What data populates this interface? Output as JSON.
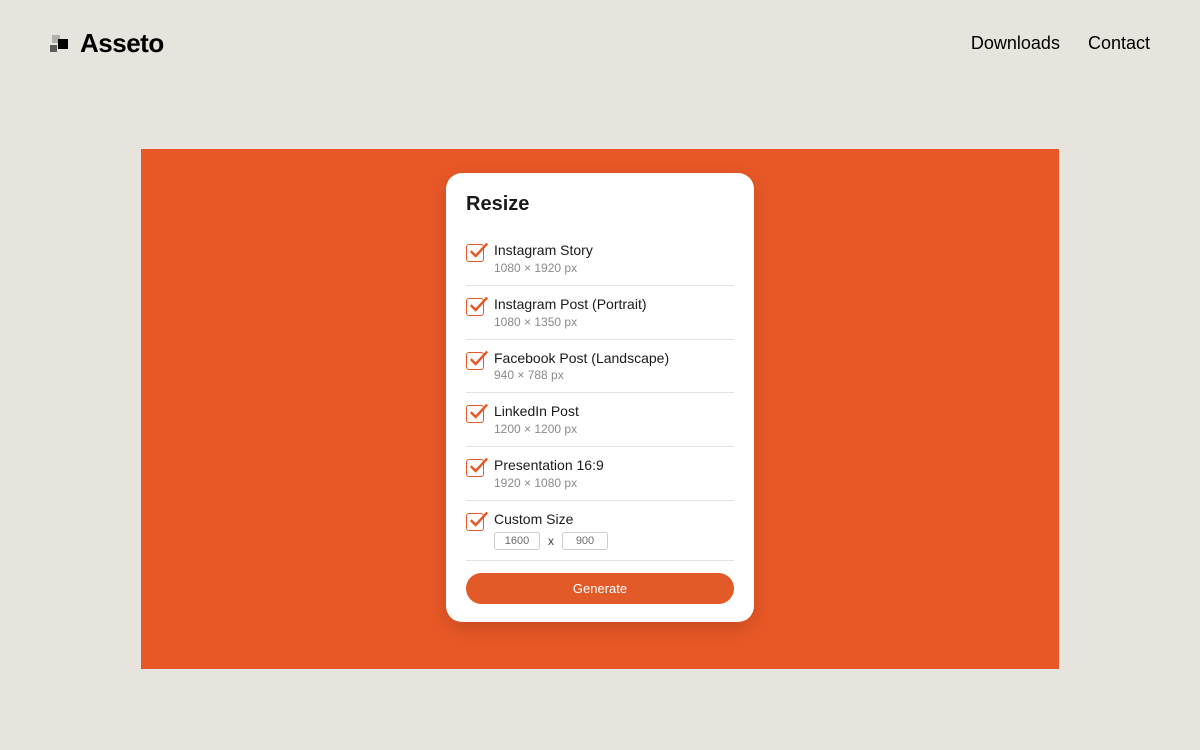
{
  "colors": {
    "accent": "#e85826",
    "page_bg": "#e6e4dd"
  },
  "header": {
    "brand_name": "Asseto",
    "nav": {
      "downloads": "Downloads",
      "contact": "Contact"
    }
  },
  "card": {
    "title": "Resize",
    "options": [
      {
        "label": "Instagram Story",
        "dimensions": "1080 × 1920 px",
        "checked": true
      },
      {
        "label": "Instagram Post (Portrait)",
        "dimensions": "1080 × 1350 px",
        "checked": true
      },
      {
        "label": "Facebook Post (Landscape)",
        "dimensions": "940 × 788 px",
        "checked": true
      },
      {
        "label": "LinkedIn Post",
        "dimensions": "1200 × 1200 px",
        "checked": true
      },
      {
        "label": "Presentation 16:9",
        "dimensions": "1920 × 1080 px",
        "checked": true
      }
    ],
    "custom": {
      "label": "Custom Size",
      "width": "1600",
      "height": "900",
      "separator": "x",
      "checked": true
    },
    "generate_label": "Generate"
  }
}
